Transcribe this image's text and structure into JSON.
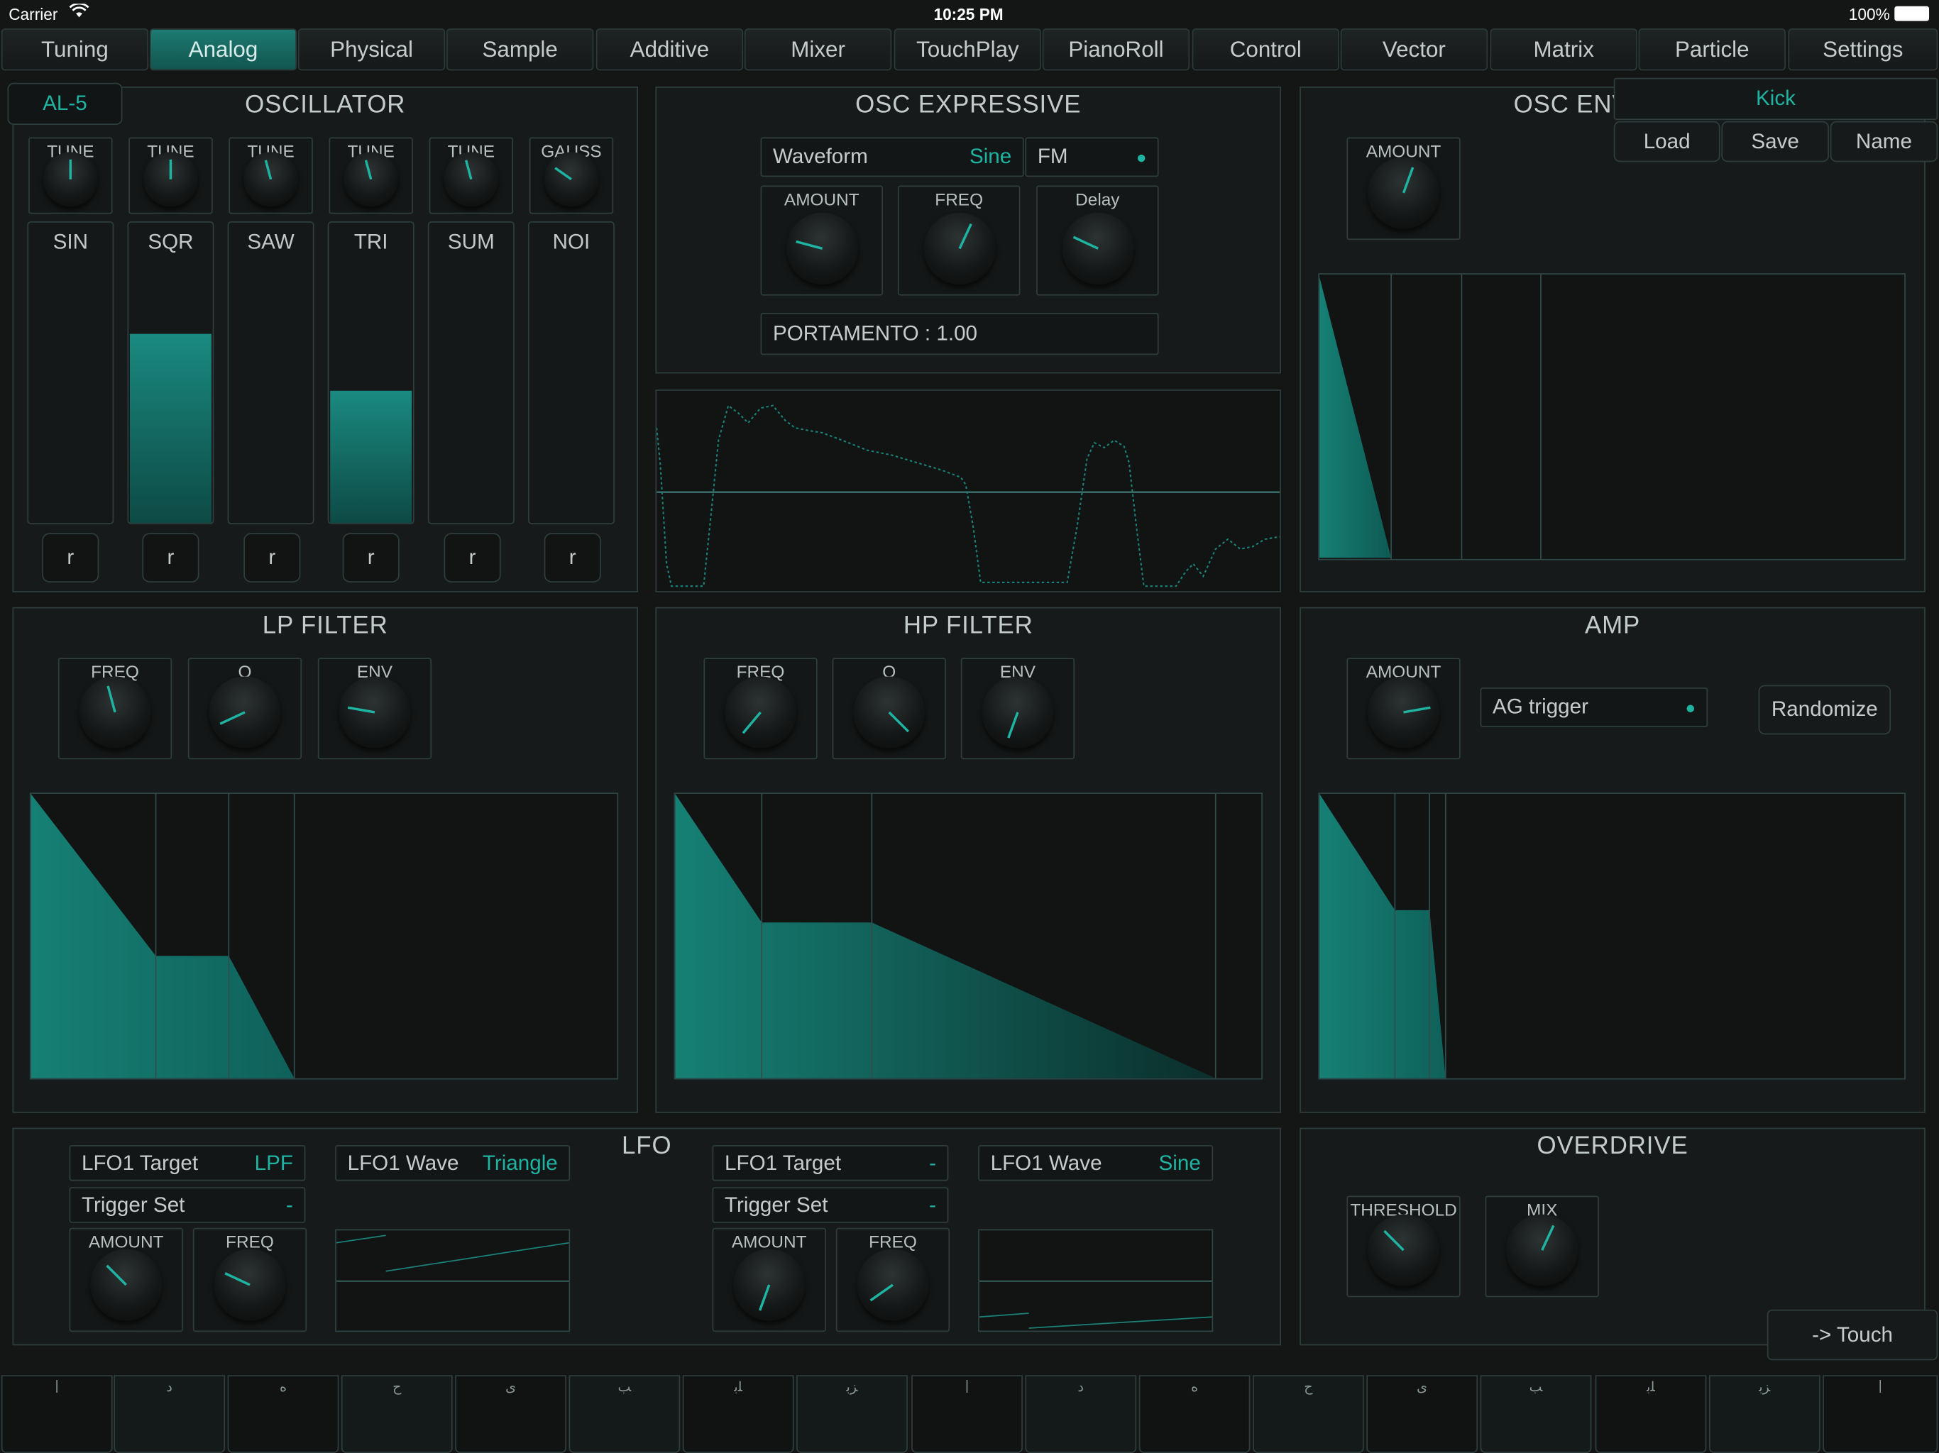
{
  "status": {
    "carrier": "Carrier",
    "time": "10:25 PM",
    "battery": "100%"
  },
  "tabs": [
    "Tuning",
    "Analog",
    "Physical",
    "Sample",
    "Additive",
    "Mixer",
    "TouchPlay",
    "PianoRoll",
    "Control",
    "Vector",
    "Matrix",
    "Particle",
    "Settings"
  ],
  "active_tab": "Analog",
  "preset": {
    "name": "Kick",
    "load": "Load",
    "save": "Save",
    "rename": "Name"
  },
  "oscillator": {
    "title": "OSCILLATOR",
    "model": "AL-5",
    "tune_labels": [
      "TUNE",
      "TUNE",
      "TUNE",
      "TUNE",
      "TUNE",
      "GAUSS"
    ],
    "tune_angles": [
      0,
      0,
      -15,
      -15,
      -15,
      -55
    ],
    "sliders": [
      {
        "label": "SIN",
        "level": 0
      },
      {
        "label": "SQR",
        "level": 0.63
      },
      {
        "label": "SAW",
        "level": 0
      },
      {
        "label": "TRI",
        "level": 0.44
      },
      {
        "label": "SUM",
        "level": 0
      },
      {
        "label": "NOI",
        "level": 0
      }
    ],
    "reset_label": "r"
  },
  "osc_expressive": {
    "title": "OSC EXPRESSIVE",
    "waveform": {
      "label": "Waveform",
      "value": "Sine"
    },
    "fm": {
      "label": "FM"
    },
    "knobs": [
      {
        "label": "AMOUNT",
        "angle": -75
      },
      {
        "label": "FREQ",
        "angle": 25
      },
      {
        "label": "Delay",
        "angle": -65
      }
    ],
    "portamento": "PORTAMENTO : 1.00"
  },
  "osc_env": {
    "title": "OSC ENV",
    "knob": {
      "label": "AMOUNT",
      "angle": 20
    }
  },
  "lp_filter": {
    "title": "LP FILTER",
    "knobs": [
      {
        "label": "FREQ",
        "angle": -15
      },
      {
        "label": "Q",
        "angle": -115
      },
      {
        "label": "ENV",
        "angle": -80
      }
    ]
  },
  "hp_filter": {
    "title": "HP FILTER",
    "knobs": [
      {
        "label": "FREQ",
        "angle": -140
      },
      {
        "label": "Q",
        "angle": 135
      },
      {
        "label": "ENV",
        "angle": -160
      }
    ]
  },
  "amp": {
    "title": "AMP",
    "knob": {
      "label": "AMOUNT",
      "angle": 80
    },
    "trigger": {
      "label": "AG trigger"
    },
    "randomize": "Randomize"
  },
  "lfo": {
    "title": "LFO",
    "lfo1": {
      "target_label": "LFO1 Target",
      "target": "LPF",
      "wave_label": "LFO1 Wave",
      "wave": "Triangle",
      "trigger_label": "Trigger Set",
      "trigger": "-",
      "knobs": [
        {
          "label": "AMOUNT",
          "angle": -45
        },
        {
          "label": "FREQ",
          "angle": -65
        }
      ]
    },
    "lfo2": {
      "target_label": "LFO1 Target",
      "target": "-",
      "wave_label": "LFO1 Wave",
      "wave": "Sine",
      "trigger_label": "Trigger Set",
      "trigger": "-",
      "knobs": [
        {
          "label": "AMOUNT",
          "angle": -160
        },
        {
          "label": "FREQ",
          "angle": -125
        }
      ]
    }
  },
  "overdrive": {
    "title": "OVERDRIVE",
    "knobs": [
      {
        "label": "THRESHOLD",
        "angle": -45
      },
      {
        "label": "MIX",
        "angle": 25
      }
    ]
  },
  "touch_button": "-> Touch",
  "keys": [
    "|",
    "ﺩ",
    "ﻩ",
    "ﺡ",
    "ﯼ",
    "ﺐ",
    "ﻠﺑ",
    "ﺰﺑ",
    "|",
    "ﺩ",
    "ﻩ",
    "ﺡ",
    "ﯼ",
    "ﺐ",
    "ﻠﺑ",
    "ﺰﺑ",
    "|"
  ],
  "colors": {
    "accent": "#1fb3a2",
    "fill": "#138075",
    "panel": "#171a1a",
    "border": "#2e3d3d"
  }
}
